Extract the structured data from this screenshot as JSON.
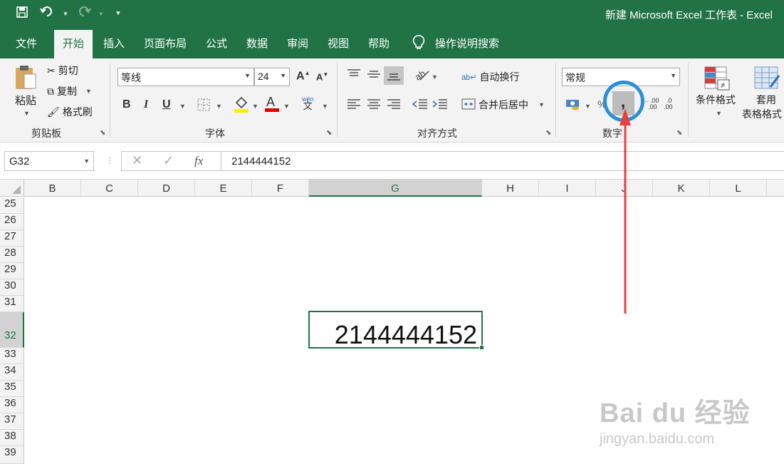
{
  "titlebar": {
    "save_icon": "save-icon",
    "undo_icon": "undo-icon",
    "redo_icon": "redo-icon",
    "title": "新建 Microsoft Excel 工作表  -  Excel"
  },
  "tabs": [
    "文件",
    "开始",
    "插入",
    "页面布局",
    "公式",
    "数据",
    "审阅",
    "视图",
    "帮助"
  ],
  "tell_me": "操作说明搜索",
  "clipboard": {
    "paste": "粘贴",
    "cut": "剪切",
    "copy": "复制",
    "format_painter": "格式刷",
    "label": "剪贴板"
  },
  "font": {
    "name": "等线",
    "size": "24",
    "label": "字体",
    "bold": "B",
    "italic": "I",
    "underline": "U",
    "grow": "A",
    "shrink": "A",
    "phonetic": "wén"
  },
  "alignment": {
    "wrap_text": "自动换行",
    "merge_center": "合并后居中",
    "label": "对齐方式"
  },
  "number": {
    "format": "常规",
    "comma": ",",
    "percent": "%",
    "inc_decimal": ".00",
    "dec_decimal": ".00",
    "label": "数字"
  },
  "styles": {
    "conditional_format": "条件格式",
    "table_format_1": "套用",
    "table_format_2": "表格格式"
  },
  "formula_bar": {
    "name_box": "G32",
    "fx": "fx",
    "value": "2144444152"
  },
  "columns": [
    "B",
    "C",
    "D",
    "E",
    "F",
    "G",
    "H",
    "I",
    "J",
    "K",
    "L"
  ],
  "rows": [
    "25",
    "26",
    "27",
    "28",
    "29",
    "30",
    "31",
    "32",
    "33",
    "34",
    "35",
    "36",
    "37",
    "38",
    "39"
  ],
  "active_cell_value": "2144444152",
  "watermark": {
    "brand": "Bai du 经验",
    "url": "jingyan.baidu.com"
  },
  "colors": {
    "excel_green": "#217346",
    "annotation_red": "#e84040",
    "highlight_blue": "#2b8fd8"
  }
}
